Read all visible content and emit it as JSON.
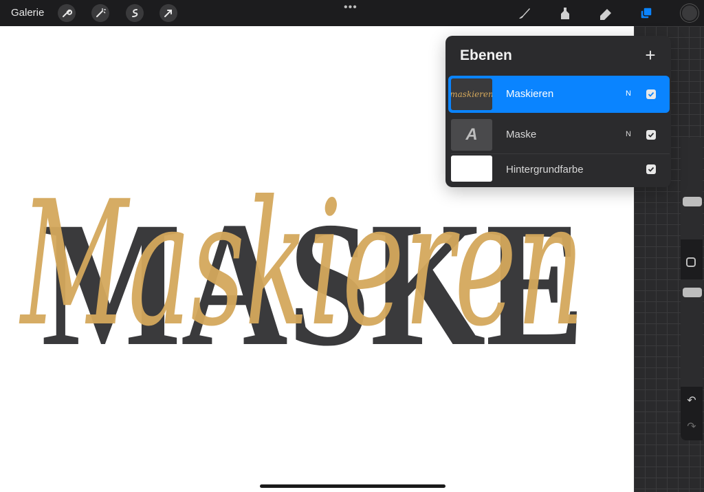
{
  "app": {
    "gallery_label": "Galerie",
    "more_menu": "•••"
  },
  "toolbar": {
    "left_tools": [
      {
        "name": "wrench-icon"
      },
      {
        "name": "magic-wand-icon"
      },
      {
        "name": "selection-icon"
      },
      {
        "name": "transform-arrow-icon"
      }
    ],
    "right_tools": [
      {
        "name": "brush-icon"
      },
      {
        "name": "smudge-icon"
      },
      {
        "name": "eraser-icon"
      },
      {
        "name": "layers-icon",
        "active": true
      }
    ],
    "current_color": "#3a3a3c"
  },
  "canvas": {
    "text_mask": "MASKE",
    "text_script": "Maskieren",
    "mask_color": "#3a3a3c",
    "script_color": "#d4a85c"
  },
  "layers_panel": {
    "title": "Ebenen",
    "add_label": "+",
    "layers": [
      {
        "name": "Maskieren",
        "mode": "N",
        "visible": true,
        "active": true,
        "thumb_text": "maskieren"
      },
      {
        "name": "Maske",
        "mode": "N",
        "visible": true,
        "active": false,
        "thumb_text": "A"
      },
      {
        "name": "Hintergrundfarbe",
        "mode": "",
        "visible": true,
        "active": false,
        "thumb_text": ""
      }
    ]
  },
  "sidebar": {
    "brush_size_level": 0.2,
    "opacity_level": 0.1,
    "undo_label": "↶",
    "redo_label": "↷"
  },
  "colors": {
    "accent": "#0a84ff",
    "toolbar_bg": "#1c1c1e",
    "panel_bg": "#2b2b2d"
  }
}
